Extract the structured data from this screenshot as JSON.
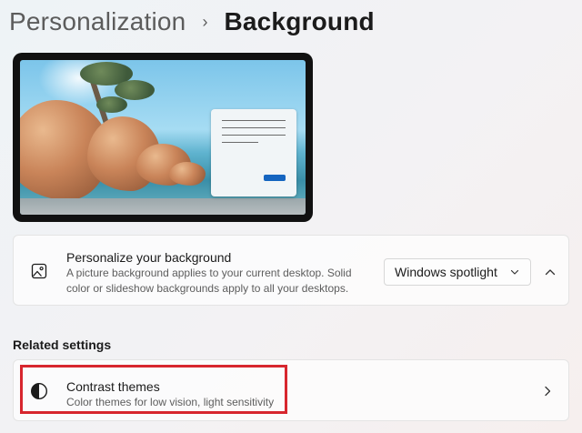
{
  "header": {
    "parent": "Personalization",
    "separator": "›",
    "current": "Background"
  },
  "preview": {
    "description_icon": "desktop-preview"
  },
  "background_setting": {
    "icon": "picture-icon",
    "title": "Personalize your background",
    "description_line1": "A picture background applies to your current desktop. Solid",
    "description_line2": "color or slideshow backgrounds apply to all your desktops.",
    "dropdown_value": "Windows spotlight",
    "expanded": true
  },
  "related": {
    "heading": "Related settings",
    "items": [
      {
        "icon": "contrast-icon",
        "title": "Contrast themes",
        "description": "Color themes for low vision, light sensitivity",
        "highlighted": true
      }
    ]
  },
  "colors": {
    "accent": "#1565c0",
    "highlight_border": "#d7262e"
  }
}
